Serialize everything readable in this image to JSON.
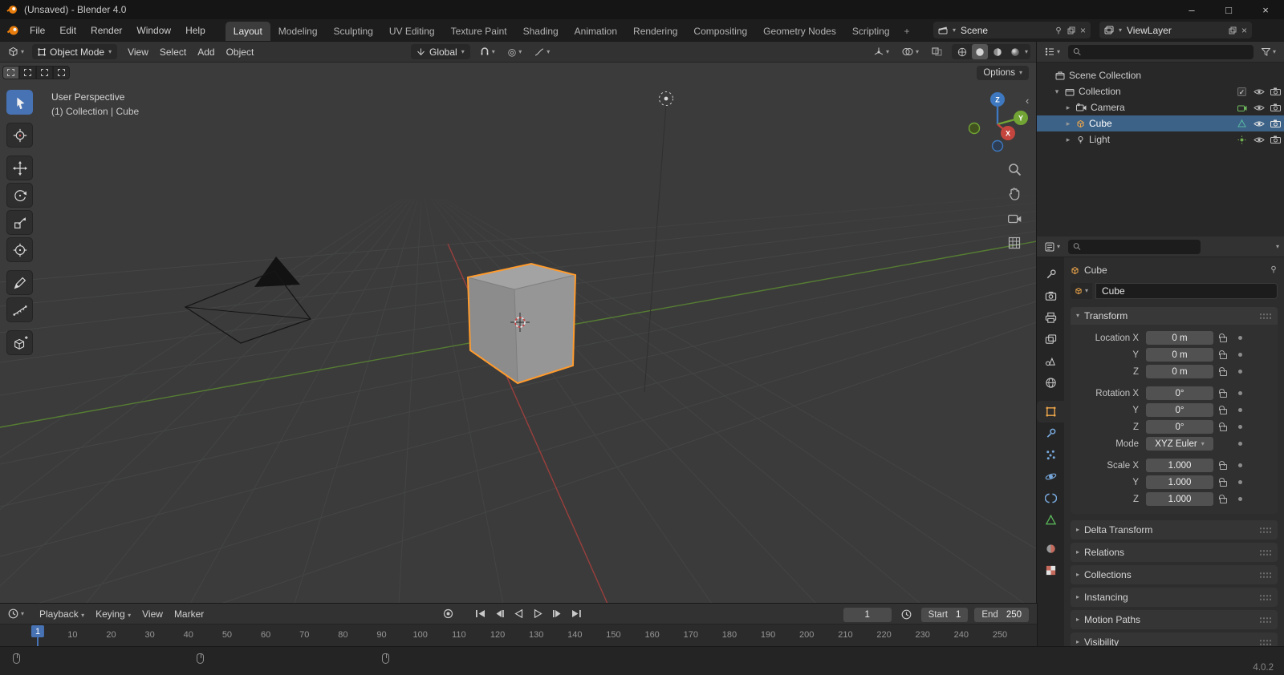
{
  "colors": {
    "accent": "#4772b3",
    "selection_orange": "#ff9b2d",
    "axis_x": "#9a3f3c",
    "axis_y": "#567d33"
  },
  "icons": {
    "search": "magnifier",
    "dropdown": "chevron-down",
    "hide_toggle": "eye",
    "render_toggle": "camera",
    "lock": "open-padlock",
    "filter": "funnel"
  },
  "titlebar": {
    "title": "(Unsaved) - Blender 4.0",
    "minimize": "–",
    "maximize": "□",
    "close": "×"
  },
  "topbar": {
    "menus": [
      "File",
      "Edit",
      "Render",
      "Window",
      "Help"
    ],
    "workspaces": [
      "Layout",
      "Modeling",
      "Sculpting",
      "UV Editing",
      "Texture Paint",
      "Shading",
      "Animation",
      "Rendering",
      "Compositing",
      "Geometry Nodes",
      "Scripting"
    ],
    "add_tab": "+",
    "scene_selector": {
      "value": "Scene"
    },
    "viewlayer_selector": {
      "value": "ViewLayer"
    }
  },
  "viewport": {
    "header": {
      "mode": "Object Mode",
      "menus": [
        "View",
        "Select",
        "Add",
        "Object"
      ],
      "orientation": "Global",
      "options": "Options"
    },
    "overlay": {
      "line1": "User Perspective",
      "line2": "(1) Collection | Cube"
    },
    "gizmo_axes": {
      "x": "X",
      "y": "Y",
      "z": "Z"
    }
  },
  "outliner": {
    "rows": [
      {
        "label": "Scene Collection"
      },
      {
        "label": "Collection"
      },
      {
        "label": "Camera"
      },
      {
        "label": "Cube"
      },
      {
        "label": "Light"
      }
    ]
  },
  "properties": {
    "breadcrumb": "Cube",
    "object_name": "Cube",
    "transform": {
      "title": "Transform",
      "rows": [
        {
          "label": "Location X",
          "value": "0 m"
        },
        {
          "label": "Y",
          "value": "0 m"
        },
        {
          "label": "Z",
          "value": "0 m"
        },
        {
          "label": "Rotation X",
          "value": "0°"
        },
        {
          "label": "Y",
          "value": "0°"
        },
        {
          "label": "Z",
          "value": "0°"
        },
        {
          "label": "Mode",
          "value": "XYZ Euler"
        },
        {
          "label": "Scale X",
          "value": "1.000"
        },
        {
          "label": "Y",
          "value": "1.000"
        },
        {
          "label": "Z",
          "value": "1.000"
        }
      ]
    },
    "sections": [
      "Delta Transform",
      "Relations",
      "Collections",
      "Instancing",
      "Motion Paths",
      "Visibility"
    ]
  },
  "timeline": {
    "menus": [
      "Playback",
      "Keying",
      "View",
      "Marker"
    ],
    "current_frame": "1",
    "start": {
      "label": "Start",
      "value": "1"
    },
    "end": {
      "label": "End",
      "value": "250"
    },
    "ticks": [
      1,
      10,
      20,
      30,
      40,
      50,
      60,
      70,
      80,
      90,
      100,
      110,
      120,
      130,
      140,
      150,
      160,
      170,
      180,
      190,
      200,
      210,
      220,
      230,
      240,
      250
    ]
  },
  "statusbar": {
    "version": "4.0.2"
  }
}
